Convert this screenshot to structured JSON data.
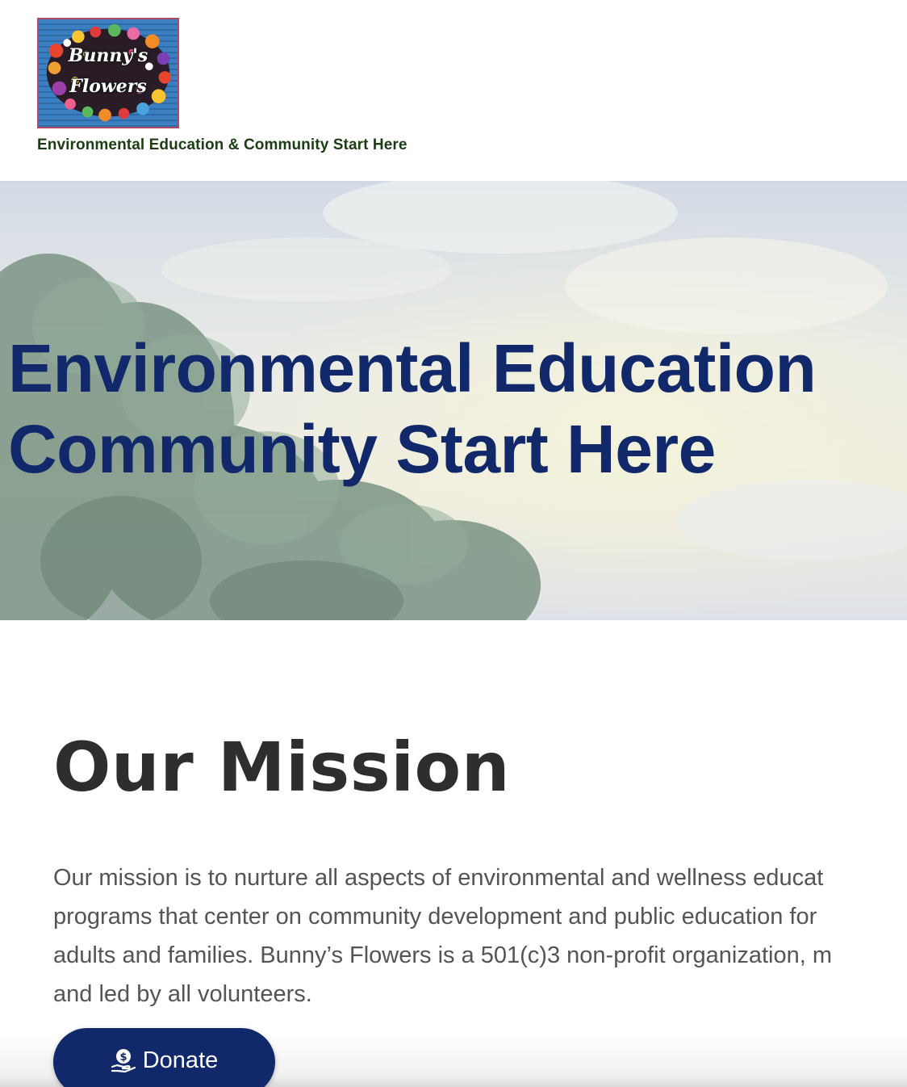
{
  "header": {
    "logo": {
      "line1": "Bunny's",
      "line2": "Flowers"
    },
    "tagline": "Environmental Education & Community Start Here"
  },
  "hero": {
    "title_line1": "Environmental Education",
    "title_line2": "Community Start Here"
  },
  "mission": {
    "title": "Our Mission",
    "lines": [
      "Our mission is to nurture all aspects of environmental and wellness educat",
      "programs that center on community development and public education for",
      "adults and families. Bunny’s Flowers is a 501(c)3 non-profit organization, m",
      "and led by all volunteers."
    ]
  },
  "donate": {
    "label": "Donate",
    "icon": "donate-hand-dollar-icon"
  },
  "colors": {
    "brand_navy": "#11296b",
    "tagline_green": "#1c3d14",
    "logo_border": "#b04a63",
    "body_text": "#545454",
    "heading_text": "#2e2e2e"
  }
}
